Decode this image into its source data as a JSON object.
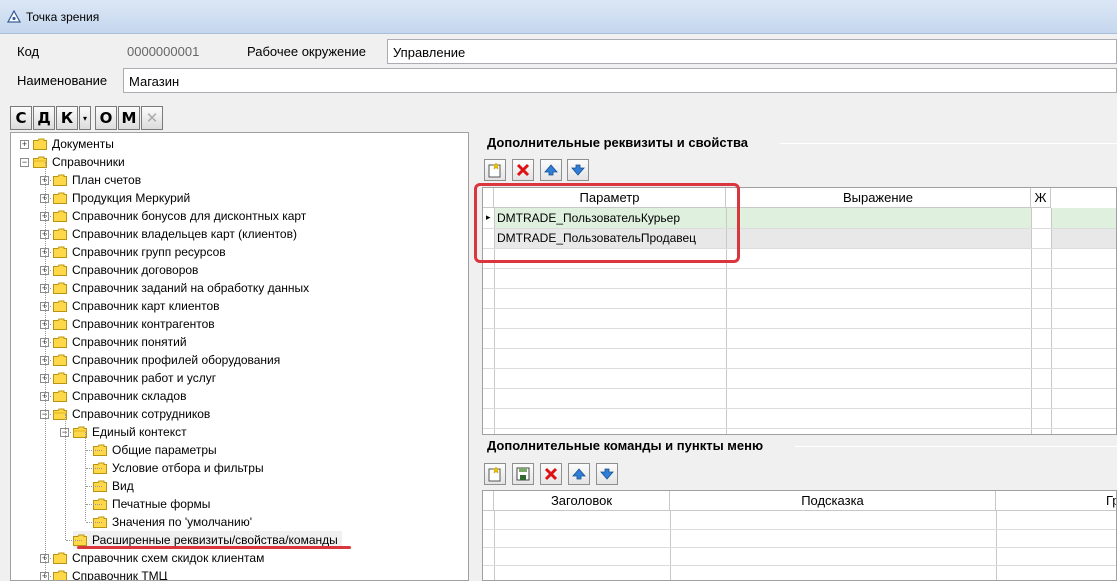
{
  "window": {
    "title": "Точка зрения"
  },
  "form": {
    "code_label": "Код",
    "code_value": "0000000001",
    "env_label": "Рабочее окружение",
    "env_value": "Управление",
    "name_label": "Наименование",
    "name_value": "Магазин"
  },
  "toolbar": {
    "buttons": [
      "С",
      "Д",
      "К",
      "▾",
      "О",
      "М",
      "✕"
    ]
  },
  "tree": {
    "items": [
      {
        "label": "Документы",
        "level": 1,
        "expander": "+"
      },
      {
        "label": "Справочники",
        "level": 1,
        "expander": "−"
      },
      {
        "label": "План счетов",
        "level": 2,
        "expander": "+"
      },
      {
        "label": "Продукция Меркурий",
        "level": 2,
        "expander": "+"
      },
      {
        "label": "Справочник бонусов для дисконтных карт",
        "level": 2,
        "expander": "+"
      },
      {
        "label": "Справочник владельцев карт (клиентов)",
        "level": 2,
        "expander": "+"
      },
      {
        "label": "Справочник групп ресурсов",
        "level": 2,
        "expander": "+"
      },
      {
        "label": "Справочник договоров",
        "level": 2,
        "expander": "+"
      },
      {
        "label": "Справочник заданий на обработку данных",
        "level": 2,
        "expander": "+"
      },
      {
        "label": "Справочник карт клиентов",
        "level": 2,
        "expander": "+"
      },
      {
        "label": "Справочник контрагентов",
        "level": 2,
        "expander": "+"
      },
      {
        "label": "Справочник понятий",
        "level": 2,
        "expander": "+"
      },
      {
        "label": "Справочник профилей оборудования",
        "level": 2,
        "expander": "+"
      },
      {
        "label": "Справочник работ и услуг",
        "level": 2,
        "expander": "+"
      },
      {
        "label": "Справочник складов",
        "level": 2,
        "expander": "+"
      },
      {
        "label": "Справочник сотрудников",
        "level": 2,
        "expander": "−"
      },
      {
        "label": "Единый контекст",
        "level": 3,
        "expander": "−"
      },
      {
        "label": "Общие параметры",
        "level": 4,
        "expander": ""
      },
      {
        "label": "Условие отбора и фильтры",
        "level": 4,
        "expander": ""
      },
      {
        "label": "Вид",
        "level": 4,
        "expander": ""
      },
      {
        "label": "Печатные формы",
        "level": 4,
        "expander": ""
      },
      {
        "label": "Значения по 'умолчанию'",
        "level": 4,
        "expander": ""
      },
      {
        "label": "Расширенные реквизиты/свойства/команды",
        "level": 3,
        "expander": ""
      },
      {
        "label": "Справочник схем скидок клиентам",
        "level": 2,
        "expander": "+"
      },
      {
        "label": "Справочник ТМЦ",
        "level": 2,
        "expander": "+"
      }
    ]
  },
  "props_section": {
    "title": "Дополнительные реквизиты и свойства",
    "columns": [
      "Параметр",
      "Выражение",
      "Ж"
    ],
    "rows": [
      {
        "param": "DMTRADE_ПользовательКурьер",
        "expr": ""
      },
      {
        "param": "DMTRADE_ПользовательПродавец",
        "expr": ""
      }
    ]
  },
  "commands_section": {
    "title": "Дополнительные команды и пункты меню",
    "columns": [
      "Заголовок",
      "Подсказка",
      "Гр"
    ]
  },
  "colors": {
    "selected_row": "#dff0df",
    "highlight": "#d9363e"
  }
}
